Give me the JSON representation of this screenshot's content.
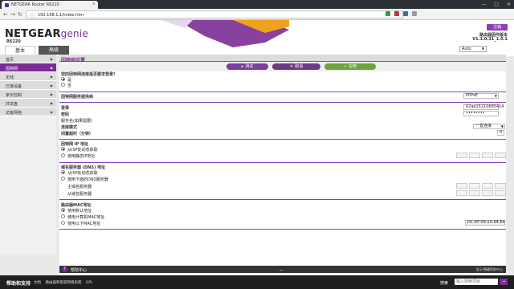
{
  "browser": {
    "tab_title": "NETGEAR Router R6220",
    "url": "192.168.1.1/index.htm",
    "close": "×",
    "win_controls": [
      "—",
      "□",
      "✕"
    ],
    "ext_colors": [
      "#2a9d4b",
      "#b33",
      "#3a6ea5",
      "#999"
    ]
  },
  "header": {
    "brand": "NETGEAR",
    "genie": "genie",
    "model": "R6220",
    "logout": "注销",
    "fw_label": "路由器固件版本",
    "fw_version": "V1.1.0.31_1.0.1",
    "tab_basic": "基本",
    "tab_advanced": "高级",
    "language": "Auto"
  },
  "sidebar": {
    "items": [
      {
        "label": "首页",
        "active": false
      },
      {
        "label": "因特网",
        "active": true
      },
      {
        "label": "无线",
        "active": false
      },
      {
        "label": "已接设备",
        "active": false
      },
      {
        "label": "家长控制",
        "active": false
      },
      {
        "label": "共享盘",
        "active": false
      },
      {
        "label": "访客网络",
        "active": false
      }
    ]
  },
  "main": {
    "title": "因特网设置",
    "buttons": {
      "test": "测试",
      "cancel": "取消",
      "apply": "应用"
    },
    "q_login": "您的因特网连接是否要求登录？",
    "yes": "是",
    "no": "否",
    "provider_label": "因特网服务提供商",
    "provider_value": "PPPoE",
    "login_label": "登录",
    "login_value": "02aa15210685414",
    "password_label": "密码",
    "password_value": "••••••••",
    "service_name_label": "服务名(如果需要)",
    "conn_mode_label": "连接模式",
    "conn_mode_value": "一直连接",
    "idle_label": "闲置超时（分钟）",
    "idle_value": "0",
    "ip_section": "因特网 IP 地址",
    "ip_dynamic": "从ISP处动态获取",
    "ip_static": "使用静态IP地址",
    "dns_section": "域名服务器 (DNS) 地址",
    "dns_dynamic": "从ISP处动态获取",
    "dns_manual": "使用下面的DNS服务器",
    "dns_primary": "主域名服务器",
    "dns_secondary": "从域名服务器",
    "mac_section": "路由器MAC地址",
    "mac_default": "使用默认地址",
    "mac_computer": "使用计算机MAC地址",
    "mac_this": "使用以下MAC地址",
    "mac_value": "DC:EF:09:15:94:E4"
  },
  "help": {
    "label": "帮助中心",
    "chevron": "︽",
    "toggle": "显示/隐藏帮助中心"
  },
  "footer": {
    "support": "帮助和支持",
    "links": [
      "文档",
      "路由器和家庭网络指南",
      "GPL"
    ],
    "search_label": "搜索",
    "search_placeholder": "输入搜索项目",
    "search_go": "→"
  }
}
